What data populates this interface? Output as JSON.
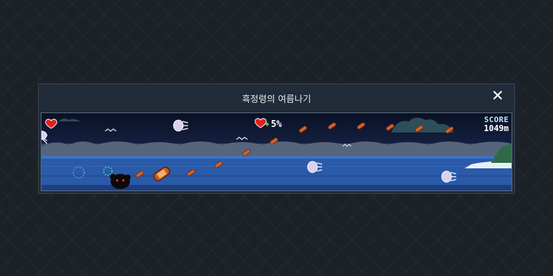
{
  "window": {
    "title": "흑정령의 여름나기",
    "close_label": "✕"
  },
  "hud": {
    "energy_percent_text": "5%",
    "score_label": "SCORE",
    "score_value": "1049m"
  },
  "icons": {
    "close": "close-icon",
    "heart": "heart-icon",
    "heart_plus": "heart-plus-icon",
    "player": "black-spirit-character",
    "jellyfish": "jellyfish-icon",
    "sausage": "sausage-icon",
    "bird": "seagull-icon"
  },
  "colors": {
    "sea": "#2a5aa8",
    "sky": "#0a1124",
    "sausage": "#d2642a",
    "heart": "#e02020"
  }
}
